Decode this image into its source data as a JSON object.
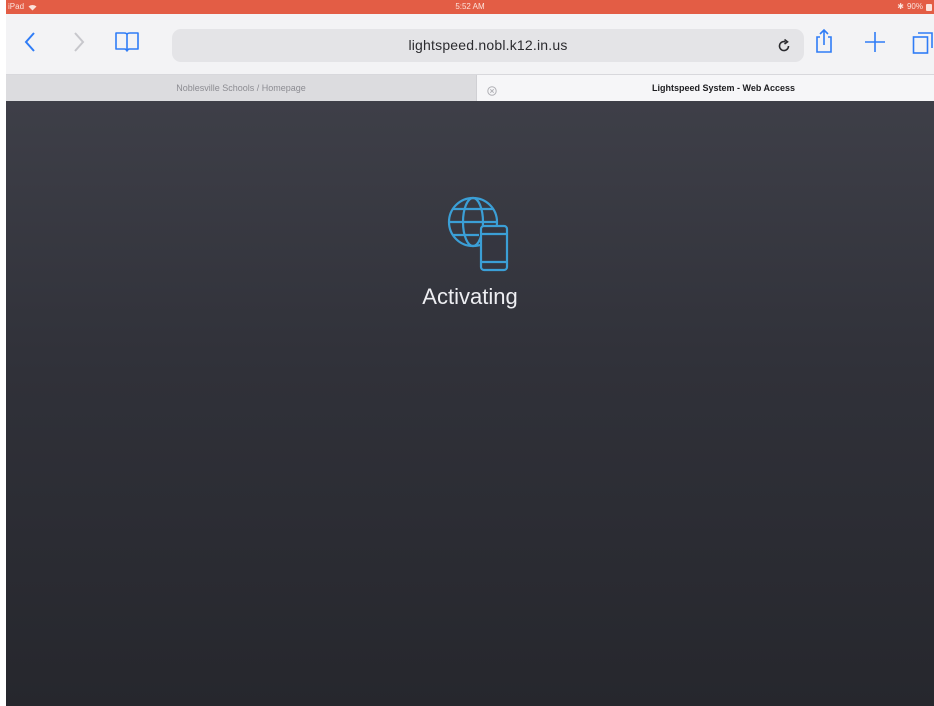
{
  "status_bar": {
    "left_label": "iPad",
    "time": "5:52 AM",
    "battery": "90%"
  },
  "toolbar": {
    "url": "lightspeed.nobl.k12.in.us"
  },
  "tabs": [
    {
      "title": "Noblesville Schools / Homepage",
      "active": false
    },
    {
      "title": "Lightspeed System - Web Access",
      "active": true
    }
  ],
  "content": {
    "status_text": "Activating",
    "icon": "globe-phone-icon",
    "accent_color": "#3b9fd6"
  },
  "colors": {
    "status_bar": "#e35d45",
    "toolbar": "#f3f3f5",
    "content_background": "#303139"
  }
}
